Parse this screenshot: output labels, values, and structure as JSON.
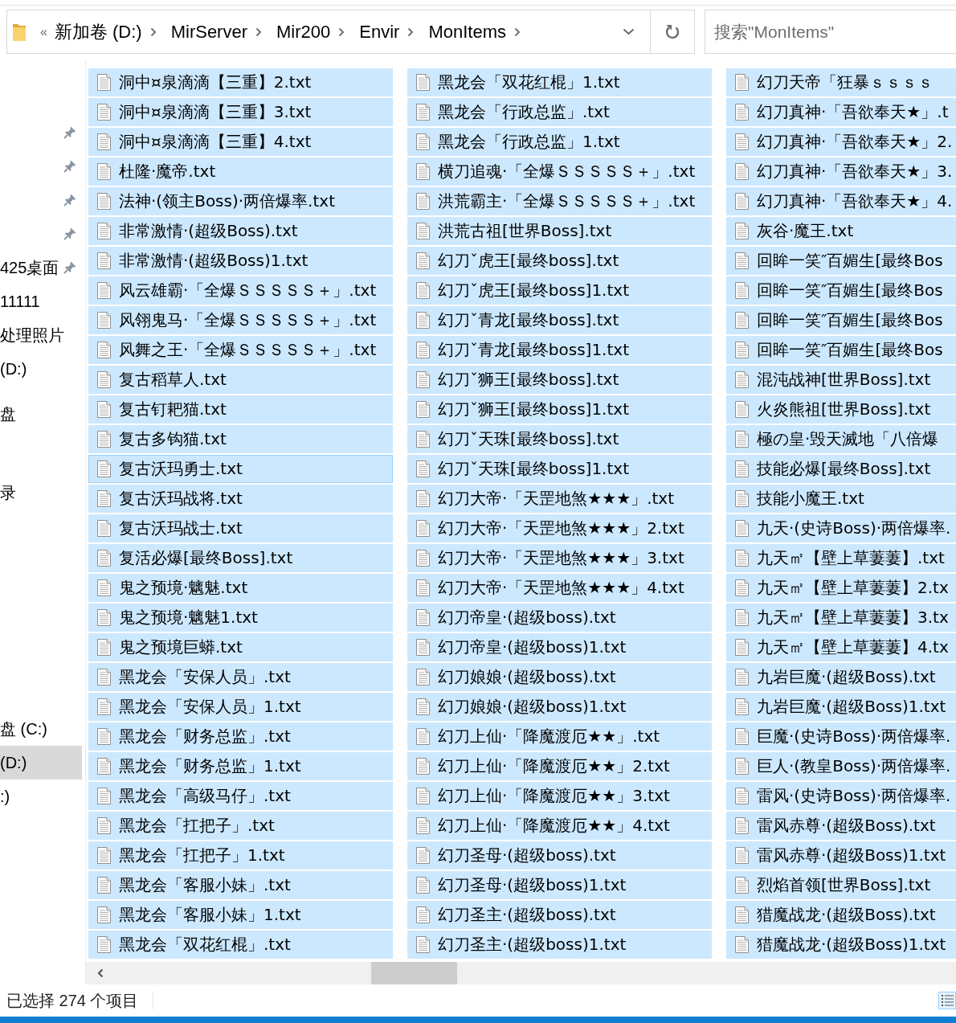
{
  "address_bar": {
    "overflow_mark": "«",
    "breadcrumbs": [
      "新加卷 (D:)",
      "MirServer",
      "Mir200",
      "Envir",
      "MonItems"
    ]
  },
  "search": {
    "placeholder": "搜索\"MonItems\""
  },
  "nav_pane": {
    "items": [
      {
        "pinned": true,
        "selected": false
      },
      {
        "pinned": true,
        "selected": false
      },
      {
        "pinned": true,
        "selected": false
      },
      {
        "pinned": true,
        "selected": false
      },
      {
        "label": "425桌面",
        "pinned": true,
        "selected": false
      },
      {
        "label": "11111",
        "pinned": false,
        "selected": false
      },
      {
        "label": "处理照片",
        "pinned": false,
        "selected": false
      },
      {
        "label": "(D:)",
        "pinned": false,
        "selected": false
      },
      {
        "label": "盘",
        "pinned": false,
        "selected": false
      },
      {
        "label": "录",
        "pinned": false,
        "selected": false
      },
      {
        "label": "盘 (C:)",
        "pinned": false,
        "selected": false
      },
      {
        "label": "(D:)",
        "pinned": false,
        "selected": true
      },
      {
        "label": ":)",
        "pinned": false,
        "selected": false
      }
    ]
  },
  "file_columns": [
    {
      "items": [
        {
          "name": "洞中¤泉滴滴【三重】2.txt",
          "selected": true,
          "focused": false
        },
        {
          "name": "洞中¤泉滴滴【三重】3.txt",
          "selected": true,
          "focused": false
        },
        {
          "name": "洞中¤泉滴滴【三重】4.txt",
          "selected": true,
          "focused": false
        },
        {
          "name": "杜隆·魔帝.txt",
          "selected": true,
          "focused": false
        },
        {
          "name": "法神·(领主Boss)·两倍爆率.txt",
          "selected": true,
          "focused": false
        },
        {
          "name": "非常激情·(超级Boss).txt",
          "selected": true,
          "focused": false
        },
        {
          "name": "非常激情·(超级Boss)1.txt",
          "selected": true,
          "focused": false
        },
        {
          "name": "风云雄霸·「全爆ＳＳＳＳＳ＋」.txt",
          "selected": true,
          "focused": false
        },
        {
          "name": "风翎鬼马·「全爆ＳＳＳＳＳ＋」.txt",
          "selected": true,
          "focused": false
        },
        {
          "name": "风舞之王·「全爆ＳＳＳＳＳ＋」.txt",
          "selected": true,
          "focused": false
        },
        {
          "name": "复古稻草人.txt",
          "selected": true,
          "focused": false
        },
        {
          "name": "复古钉耙猫.txt",
          "selected": true,
          "focused": false
        },
        {
          "name": "复古多钩猫.txt",
          "selected": true,
          "focused": false
        },
        {
          "name": "复古沃玛勇士.txt",
          "selected": true,
          "focused": true
        },
        {
          "name": "复古沃玛战将.txt",
          "selected": true,
          "focused": false
        },
        {
          "name": "复古沃玛战士.txt",
          "selected": true,
          "focused": false
        },
        {
          "name": "复活必爆[最终Boss].txt",
          "selected": true,
          "focused": false
        },
        {
          "name": "鬼之预境·魑魅.txt",
          "selected": true,
          "focused": false
        },
        {
          "name": "鬼之预境·魑魅1.txt",
          "selected": true,
          "focused": false
        },
        {
          "name": "鬼之预境巨蟒.txt",
          "selected": true,
          "focused": false
        },
        {
          "name": "黑龙会「安保人员」.txt",
          "selected": true,
          "focused": false
        },
        {
          "name": "黑龙会「安保人员」1.txt",
          "selected": true,
          "focused": false
        },
        {
          "name": "黑龙会「财务总监」.txt",
          "selected": true,
          "focused": false
        },
        {
          "name": "黑龙会「财务总监」1.txt",
          "selected": true,
          "focused": false
        },
        {
          "name": "黑龙会「高级马仔」.txt",
          "selected": true,
          "focused": false
        },
        {
          "name": "黑龙会「扛把子」.txt",
          "selected": true,
          "focused": false
        },
        {
          "name": "黑龙会「扛把子」1.txt",
          "selected": true,
          "focused": false
        },
        {
          "name": "黑龙会「客服小妹」.txt",
          "selected": true,
          "focused": false
        },
        {
          "name": "黑龙会「客服小妹」1.txt",
          "selected": true,
          "focused": false
        },
        {
          "name": "黑龙会「双花红棍」.txt",
          "selected": true,
          "focused": false
        }
      ]
    },
    {
      "items": [
        {
          "name": "黑龙会「双花红棍」1.txt",
          "selected": true,
          "focused": false
        },
        {
          "name": "黑龙会「行政总监」.txt",
          "selected": true,
          "focused": false
        },
        {
          "name": "黑龙会「行政总监」1.txt",
          "selected": true,
          "focused": false
        },
        {
          "name": "横刀追魂·「全爆ＳＳＳＳＳ＋」.txt",
          "selected": true,
          "focused": false
        },
        {
          "name": "洪荒霸主·「全爆ＳＳＳＳＳ＋」.txt",
          "selected": true,
          "focused": false
        },
        {
          "name": "洪荒古祖[世界Boss].txt",
          "selected": true,
          "focused": false
        },
        {
          "name": "幻刀ˇ虎王[最终boss].txt",
          "selected": true,
          "focused": false
        },
        {
          "name": "幻刀ˇ虎王[最终boss]1.txt",
          "selected": true,
          "focused": false
        },
        {
          "name": "幻刀ˇ青龙[最终boss].txt",
          "selected": true,
          "focused": false
        },
        {
          "name": "幻刀ˇ青龙[最终boss]1.txt",
          "selected": true,
          "focused": false
        },
        {
          "name": "幻刀ˇ狮王[最终boss].txt",
          "selected": true,
          "focused": false
        },
        {
          "name": "幻刀ˇ狮王[最终boss]1.txt",
          "selected": true,
          "focused": false
        },
        {
          "name": "幻刀ˇ天珠[最终boss].txt",
          "selected": true,
          "focused": false
        },
        {
          "name": "幻刀ˇ天珠[最终boss]1.txt",
          "selected": true,
          "focused": false
        },
        {
          "name": "幻刀大帝·「天罡地煞★★★」.txt",
          "selected": true,
          "focused": false
        },
        {
          "name": "幻刀大帝·「天罡地煞★★★」2.txt",
          "selected": true,
          "focused": false
        },
        {
          "name": "幻刀大帝·「天罡地煞★★★」3.txt",
          "selected": true,
          "focused": false
        },
        {
          "name": "幻刀大帝·「天罡地煞★★★」4.txt",
          "selected": true,
          "focused": false
        },
        {
          "name": "幻刀帝皇·(超级boss).txt",
          "selected": true,
          "focused": false
        },
        {
          "name": "幻刀帝皇·(超级boss)1.txt",
          "selected": true,
          "focused": false
        },
        {
          "name": "幻刀娘娘·(超级boss).txt",
          "selected": true,
          "focused": false
        },
        {
          "name": "幻刀娘娘·(超级boss)1.txt",
          "selected": true,
          "focused": false
        },
        {
          "name": "幻刀上仙·「降魔渡厄★★」.txt",
          "selected": true,
          "focused": false
        },
        {
          "name": "幻刀上仙·「降魔渡厄★★」2.txt",
          "selected": true,
          "focused": false
        },
        {
          "name": "幻刀上仙·「降魔渡厄★★」3.txt",
          "selected": true,
          "focused": false
        },
        {
          "name": "幻刀上仙·「降魔渡厄★★」4.txt",
          "selected": true,
          "focused": false
        },
        {
          "name": "幻刀圣母·(超级boss).txt",
          "selected": true,
          "focused": false
        },
        {
          "name": "幻刀圣母·(超级boss)1.txt",
          "selected": true,
          "focused": false
        },
        {
          "name": "幻刀圣主·(超级boss).txt",
          "selected": true,
          "focused": false
        },
        {
          "name": "幻刀圣主·(超级boss)1.txt",
          "selected": true,
          "focused": false
        }
      ]
    },
    {
      "items": [
        {
          "name": "幻刀天帝「狂暴ｓｓｓｓ",
          "selected": true,
          "focused": false
        },
        {
          "name": "幻刀真神·「吾欲奉天★」.t",
          "selected": true,
          "focused": false
        },
        {
          "name": "幻刀真神·「吾欲奉天★」2.",
          "selected": true,
          "focused": false
        },
        {
          "name": "幻刀真神·「吾欲奉天★」3.",
          "selected": true,
          "focused": false
        },
        {
          "name": "幻刀真神·「吾欲奉天★」4.",
          "selected": true,
          "focused": false
        },
        {
          "name": "灰谷·魔王.txt",
          "selected": true,
          "focused": false
        },
        {
          "name": "回眸一笑″百媚生[最终Bos",
          "selected": true,
          "focused": false
        },
        {
          "name": "回眸一笑″百媚生[最终Bos",
          "selected": true,
          "focused": false
        },
        {
          "name": "回眸一笑″百媚生[最终Bos",
          "selected": true,
          "focused": false
        },
        {
          "name": "回眸一笑″百媚生[最终Bos",
          "selected": true,
          "focused": false
        },
        {
          "name": "混沌战神[世界Boss].txt",
          "selected": true,
          "focused": false
        },
        {
          "name": "火炎熊祖[世界Boss].txt",
          "selected": true,
          "focused": false
        },
        {
          "name": "極の皇·毁天滅地「八倍爆",
          "selected": true,
          "focused": false
        },
        {
          "name": "技能必爆[最终Boss].txt",
          "selected": true,
          "focused": false
        },
        {
          "name": "技能小魔王.txt",
          "selected": true,
          "focused": false
        },
        {
          "name": "九天·(史诗Boss)·两倍爆率.",
          "selected": true,
          "focused": false
        },
        {
          "name": "九天㎡【壁上草萋萋】.txt",
          "selected": true,
          "focused": false
        },
        {
          "name": "九天㎡【壁上草萋萋】2.tx",
          "selected": true,
          "focused": false
        },
        {
          "name": "九天㎡【壁上草萋萋】3.tx",
          "selected": true,
          "focused": false
        },
        {
          "name": "九天㎡【壁上草萋萋】4.tx",
          "selected": true,
          "focused": false
        },
        {
          "name": "九岩巨魔·(超级Boss).txt",
          "selected": true,
          "focused": false
        },
        {
          "name": "九岩巨魔·(超级Boss)1.txt",
          "selected": true,
          "focused": false
        },
        {
          "name": "巨魔·(史诗Boss)·两倍爆率.",
          "selected": true,
          "focused": false
        },
        {
          "name": "巨人·(教皇Boss)·两倍爆率.",
          "selected": true,
          "focused": false
        },
        {
          "name": "雷风·(史诗Boss)·两倍爆率.",
          "selected": true,
          "focused": false
        },
        {
          "name": "雷风赤尊·(超级Boss).txt",
          "selected": true,
          "focused": false
        },
        {
          "name": "雷风赤尊·(超级Boss)1.txt",
          "selected": true,
          "focused": false
        },
        {
          "name": "烈焰首领[世界Boss].txt",
          "selected": true,
          "focused": false
        },
        {
          "name": "猎魔战龙·(超级Boss).txt",
          "selected": true,
          "focused": false
        },
        {
          "name": "猎魔战龙·(超级Boss)1.txt",
          "selected": true,
          "focused": false
        }
      ]
    }
  ],
  "status_bar": {
    "selection": "已选择 274 个项目"
  }
}
